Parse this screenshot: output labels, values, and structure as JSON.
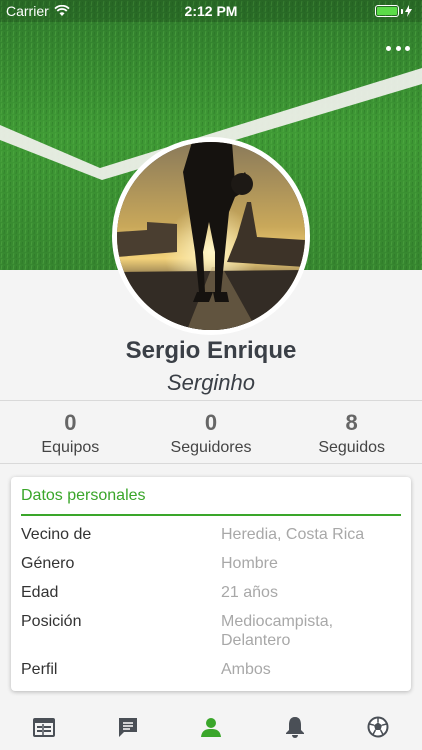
{
  "status_bar": {
    "carrier": "Carrier",
    "time": "2:12 PM",
    "battery_level": 1.0,
    "battery_color": "#5bdc48"
  },
  "header": {
    "more_icon": "more-horizontal-icon"
  },
  "profile": {
    "name": "Sergio Enrique",
    "nickname": "Serginho"
  },
  "stats": [
    {
      "value": "0",
      "label": "Equipos"
    },
    {
      "value": "0",
      "label": "Seguidores"
    },
    {
      "value": "8",
      "label": "Seguidos"
    }
  ],
  "personal": {
    "title": "Datos personales",
    "rows": [
      {
        "key": "Vecino de",
        "value": "Heredia, Costa Rica"
      },
      {
        "key": "Género",
        "value": "Hombre"
      },
      {
        "key": "Edad",
        "value": "21 años"
      },
      {
        "key": "Posición",
        "value": "Mediocampista,\nDelantero"
      },
      {
        "key": "Perfil",
        "value": "Ambos"
      }
    ]
  },
  "tabs": [
    {
      "icon": "calendar-icon",
      "active": false
    },
    {
      "icon": "chat-icon",
      "active": false
    },
    {
      "icon": "profile-icon",
      "active": true
    },
    {
      "icon": "bell-icon",
      "active": false
    },
    {
      "icon": "soccer-ball-icon",
      "active": false
    }
  ],
  "colors": {
    "accent": "#3aa62a",
    "tab_inactive": "#4a4f56",
    "tab_active": "#3aa62a"
  }
}
